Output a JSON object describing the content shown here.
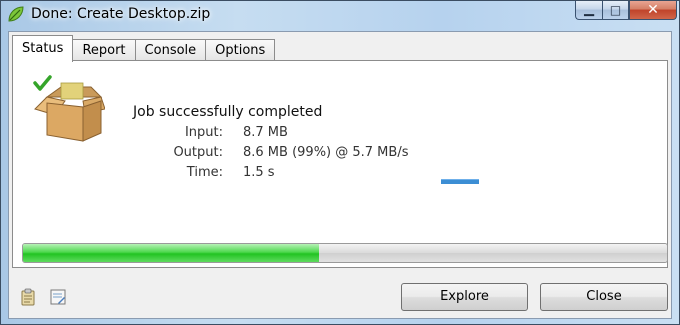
{
  "window": {
    "title": "Done: Create Desktop.zip",
    "controls": {
      "minimize_icon": "minimize-icon",
      "maximize_icon": "maximize-icon",
      "close_icon": "close-icon"
    }
  },
  "tabs": [
    {
      "label": "Status",
      "active": true
    },
    {
      "label": "Report",
      "active": false
    },
    {
      "label": "Console",
      "active": false
    },
    {
      "label": "Options",
      "active": false
    }
  ],
  "status": {
    "message": "Job successfully completed",
    "rows": [
      {
        "label": "Input:",
        "value": "8.7 MB"
      },
      {
        "label": "Output:",
        "value": "8.6 MB (99%) @ 5.7 MB/s"
      },
      {
        "label": "Time:",
        "value": "1.5 s"
      }
    ],
    "progress_fraction": 0.46
  },
  "footer": {
    "left_icons": [
      "clipboard-icon",
      "log-icon"
    ],
    "explore_label": "Explore",
    "close_label": "Close"
  },
  "colors": {
    "progress_green": "#22c322",
    "mini_bar_blue": "#3c8ed4",
    "close_button_red": "#c0432a"
  }
}
